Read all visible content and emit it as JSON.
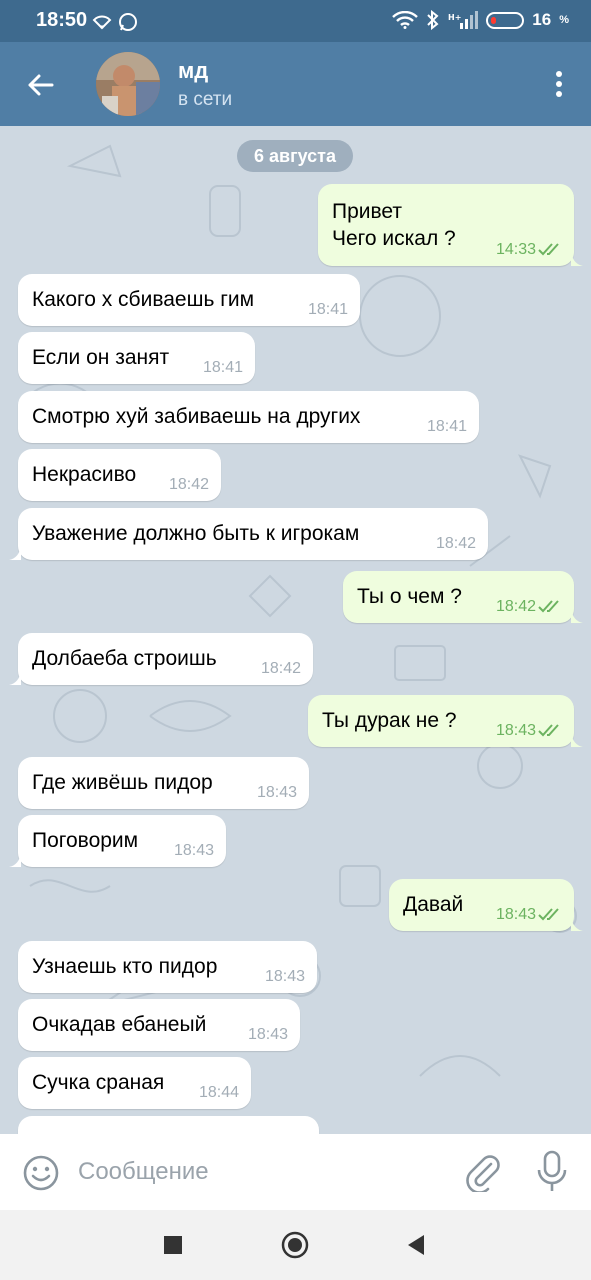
{
  "status_bar": {
    "time": "18:50",
    "left_icons": [
      "wifi-icon",
      "whatsapp-icon"
    ],
    "right_icons": [
      "wifi-icon",
      "bluetooth-icon",
      "signal-icon",
      "battery-icon"
    ],
    "battery_level": "16",
    "battery_sign": "%"
  },
  "header": {
    "contact_name": "мд",
    "presence": "в сети",
    "icons": {
      "back": "back-arrow-icon",
      "menu": "more-vert-icon"
    },
    "colors": {
      "bar": "#507ea5",
      "status": "#3e6a8e"
    }
  },
  "chat": {
    "date_separator": "6 августа",
    "colors": {
      "incoming": "#ffffff",
      "outgoing": "#effdde",
      "read_ticks": "#6cb360",
      "background": "#ced8e1"
    },
    "messages": [
      {
        "dir": "out",
        "text": "Привет",
        "text2": "Чего искал ?",
        "time": "14:33",
        "read": true
      },
      {
        "dir": "in",
        "text": "Какого х сбиваешь гим",
        "time": "18:41"
      },
      {
        "dir": "in",
        "text": "Если он занят",
        "time": "18:41"
      },
      {
        "dir": "in",
        "text": "Смотрю хуй забиваешь на других",
        "time": "18:41"
      },
      {
        "dir": "in",
        "text": "Некрасиво",
        "time": "18:42"
      },
      {
        "dir": "in",
        "text": "Уважение должно быть к игрокам",
        "time": "18:42"
      },
      {
        "dir": "out",
        "text": "Ты о чем ?",
        "time": "18:42",
        "read": true
      },
      {
        "dir": "in",
        "text": "Долбаеба строишь",
        "time": "18:42"
      },
      {
        "dir": "out",
        "text": "Ты дурак не ?",
        "time": "18:43",
        "read": true
      },
      {
        "dir": "in",
        "text": "Где живёшь пидор",
        "time": "18:43"
      },
      {
        "dir": "in",
        "text": "Поговорим",
        "time": "18:43"
      },
      {
        "dir": "out",
        "text": "Давай",
        "time": "18:43",
        "read": true
      },
      {
        "dir": "in",
        "text": "Узнаешь кто пидор",
        "time": "18:43"
      },
      {
        "dir": "in",
        "text": "Очкадав ебанеый",
        "time": "18:43"
      },
      {
        "dir": "in",
        "text": "Сучка сраная",
        "time": "18:44"
      }
    ]
  },
  "composer": {
    "placeholder": "Сообщение",
    "value": "",
    "icons": {
      "emoji": "emoji-icon",
      "attach": "paperclip-icon",
      "mic": "microphone-icon"
    }
  },
  "navigation_bar": {
    "icons": [
      "recents-square-icon",
      "home-circle-icon",
      "back-triangle-icon"
    ]
  }
}
